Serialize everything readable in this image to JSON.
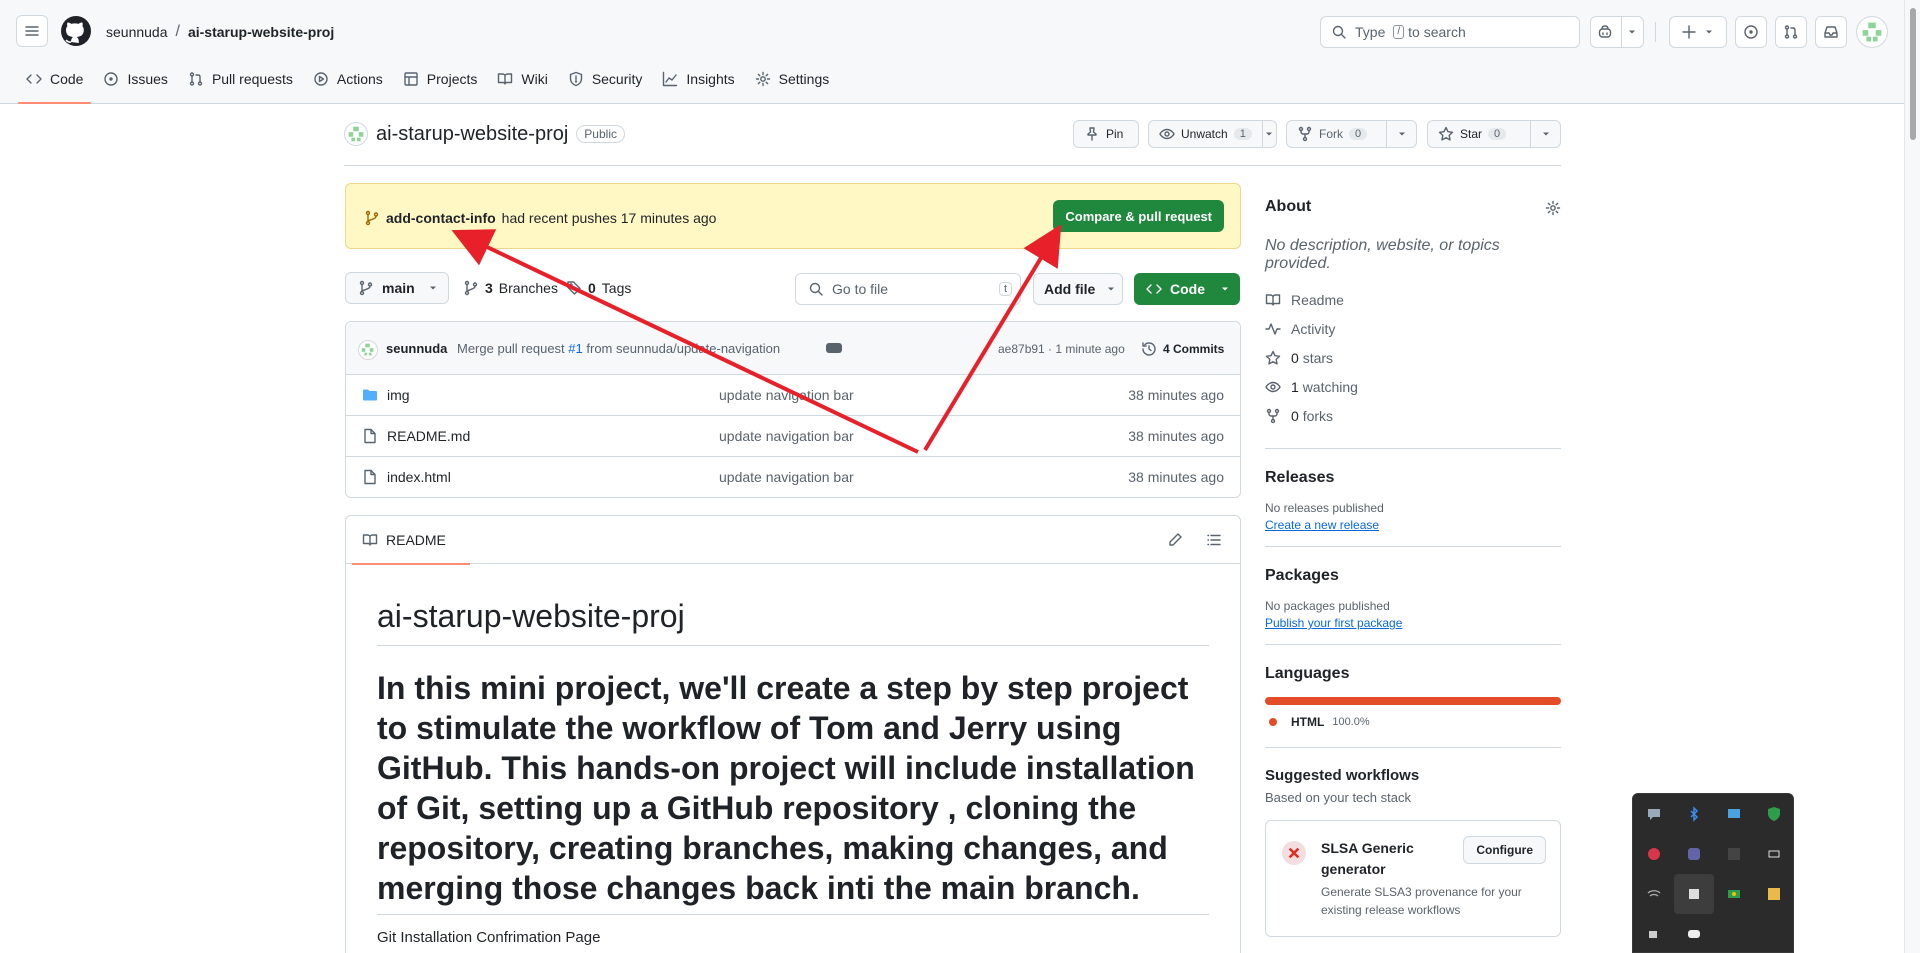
{
  "header": {
    "owner": "seunnuda",
    "separator": "/",
    "repo": "ai-starup-website-proj",
    "search_prefix": "Type",
    "search_key": "/",
    "search_suffix": "to search"
  },
  "repo_nav": [
    {
      "label": "Code",
      "icon": "code-icon"
    },
    {
      "label": "Issues",
      "icon": "issue-opened-icon"
    },
    {
      "label": "Pull requests",
      "icon": "git-pull-request-icon"
    },
    {
      "label": "Actions",
      "icon": "play-icon"
    },
    {
      "label": "Projects",
      "icon": "table-icon"
    },
    {
      "label": "Wiki",
      "icon": "book-icon"
    },
    {
      "label": "Security",
      "icon": "shield-icon"
    },
    {
      "label": "Insights",
      "icon": "graph-icon"
    },
    {
      "label": "Settings",
      "icon": "gear-icon"
    }
  ],
  "repo_header": {
    "name": "ai-starup-website-proj",
    "visibility": "Public",
    "pin_label": "Pin",
    "watch_label": "Unwatch",
    "watch_count": "1",
    "fork_label": "Fork",
    "fork_count": "0",
    "star_label": "Star",
    "star_count": "0"
  },
  "banner": {
    "branch": "add-contact-info",
    "text": "had recent pushes 17 minutes ago",
    "button": "Compare & pull request"
  },
  "toolbar": {
    "branch": "main",
    "branches_count": "3",
    "branches_label": "Branches",
    "tags_count": "0",
    "tags_label": "Tags",
    "goto_placeholder": "Go to file",
    "goto_key": "t",
    "add_file": "Add file",
    "code": "Code"
  },
  "latest_commit": {
    "author": "seunnuda",
    "message_prefix": "Merge pull request",
    "pr": "#1",
    "message_suffix": "from seunnuda/update-navigation",
    "sha_time": "ae87b91 · 1 minute ago",
    "commits": "4 Commits"
  },
  "files": [
    {
      "name": "img",
      "type": "folder",
      "message": "update navigation bar",
      "age": "38 minutes ago"
    },
    {
      "name": "README.md",
      "type": "file",
      "message": "update navigation bar",
      "age": "38 minutes ago"
    },
    {
      "name": "index.html",
      "type": "file",
      "message": "update navigation bar",
      "age": "38 minutes ago"
    }
  ],
  "readme": {
    "tab": "README",
    "title": "ai-starup-website-proj",
    "heading": "In this mini project, we'll create a step by step project to stimulate the workflow of Tom and Jerry using GitHub. This hands-on project will include installation of Git, setting up a GitHub repository , cloning the repository, creating branches, making changes, and merging those changes back inti the main branch.",
    "paragraph": "Git Installation Confrimation Page"
  },
  "about": {
    "title": "About",
    "description": "No description, website, or topics provided.",
    "items": [
      {
        "icon": "book-icon",
        "label": "Readme",
        "count": ""
      },
      {
        "icon": "pulse-icon",
        "label": "Activity",
        "count": ""
      },
      {
        "icon": "star-icon",
        "label": "stars",
        "count": "0"
      },
      {
        "icon": "eye-icon",
        "label": "watching",
        "count": "1"
      },
      {
        "icon": "fork-icon",
        "label": "forks",
        "count": "0"
      }
    ]
  },
  "releases": {
    "title": "Releases",
    "text": "No releases published",
    "link": "Create a new release"
  },
  "packages": {
    "title": "Packages",
    "text": "No packages published",
    "link": "Publish your first package"
  },
  "languages": {
    "title": "Languages",
    "items": [
      {
        "name": "HTML",
        "percent": "100.0%",
        "color": "#e34c26"
      }
    ]
  },
  "workflows": {
    "title": "Suggested workflows",
    "subtitle": "Based on your tech stack",
    "card": {
      "name": "SLSA Generic generator",
      "button": "Configure",
      "description": "Generate SLSA3 provenance for your existing release workflows"
    }
  },
  "colors": {
    "accent_green": "#1f883d",
    "banner_bg": "#fff8c5",
    "arrow_red": "#e8202a"
  }
}
